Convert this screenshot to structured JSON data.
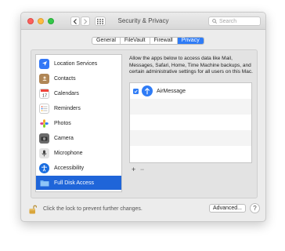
{
  "window": {
    "title": "Security & Privacy"
  },
  "search": {
    "placeholder": "Search"
  },
  "tabs": [
    {
      "label": "General"
    },
    {
      "label": "FileVault"
    },
    {
      "label": "Firewall"
    },
    {
      "label": "Privacy",
      "active": true
    }
  ],
  "sidebar": {
    "items": [
      {
        "label": "Location Services",
        "icon": "location-arrow-icon"
      },
      {
        "label": "Contacts",
        "icon": "contacts-book-icon"
      },
      {
        "label": "Calendars",
        "icon": "calendar-icon"
      },
      {
        "label": "Reminders",
        "icon": "reminders-list-icon"
      },
      {
        "label": "Photos",
        "icon": "photos-flower-icon"
      },
      {
        "label": "Camera",
        "icon": "camera-icon"
      },
      {
        "label": "Microphone",
        "icon": "microphone-icon"
      },
      {
        "label": "Accessibility",
        "icon": "accessibility-icon"
      },
      {
        "label": "Full Disk Access",
        "icon": "folder-icon",
        "selected": true
      }
    ]
  },
  "main": {
    "description": "Allow the apps below to access data like Mail, Messages, Safari, Home, Time Machine backups, and certain administrative settings for all users on this Mac.",
    "apps": [
      {
        "name": "AirMessage",
        "checked": true,
        "icon": "airmessage-icon"
      }
    ],
    "add_label": "+",
    "remove_label": "−"
  },
  "footer": {
    "lock_text": "Click the lock to prevent further changes.",
    "advanced_label": "Advanced...",
    "help_label": "?"
  },
  "colors": {
    "accent": "#2f7cf6",
    "selection": "#1f65d9",
    "close": "#fc605c",
    "minimize": "#fdbc40",
    "maximize": "#34c84a"
  }
}
